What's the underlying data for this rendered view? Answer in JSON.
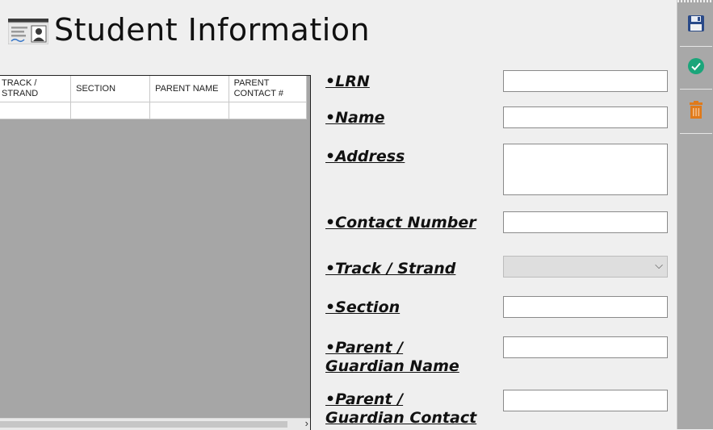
{
  "header": {
    "title": "Student Information",
    "logo_icon": "student-id-card-icon"
  },
  "grid": {
    "columns": [
      "TRACK / STRAND",
      "SECTION",
      "PARENT NAME",
      "PARENT CONTACT #"
    ],
    "rows": [
      [
        "",
        "",
        "",
        ""
      ]
    ]
  },
  "form": {
    "lrn_label": "•LRN",
    "lrn_value": "",
    "name_label": "•Name",
    "name_value": "",
    "address_label": "•Address",
    "address_value": "",
    "contact_label": "•Contact Number",
    "contact_value": "",
    "track_label": "•Track / Strand",
    "track_value": "",
    "section_label": "•Section",
    "section_value": "",
    "parent_name_label": "•Parent / Guardian Name",
    "parent_name_value": "",
    "parent_contact_label": "•Parent / Guardian Contact",
    "parent_contact_value": ""
  },
  "toolbar": {
    "save_icon": "save-icon",
    "confirm_icon": "check-circle-icon",
    "delete_icon": "delete-icon",
    "colors": {
      "confirm": "#1aa57a",
      "delete": "#e07a1a",
      "save": "#2a4a88"
    }
  }
}
